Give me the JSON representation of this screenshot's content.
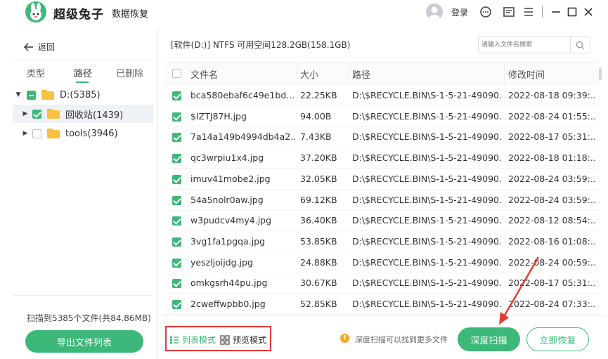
{
  "titlebar": {
    "app_name": "超级兔子",
    "app_sub": "数据恢复",
    "login": "登录"
  },
  "sidebar": {
    "back": "返回",
    "tabs": [
      "类型",
      "路径",
      "已删除"
    ],
    "active_tab": "路径",
    "tree": [
      {
        "label": "D:(5385)",
        "state": "partial",
        "expanded": true
      },
      {
        "label": "回收站(1439)",
        "state": "checked",
        "expanded": false
      },
      {
        "label": "tools(3946)",
        "state": "unchecked",
        "expanded": false
      }
    ],
    "scan_info": "扫描到5385个文件(共84.86MB)",
    "export_label": "导出文件列表"
  },
  "main": {
    "path_bar": "[软件(D:)] NTFS 可用空间128.2GB(158.1GB)",
    "search_placeholder": "请输入文件名搜索",
    "columns": [
      "文件名",
      "大小",
      "路径",
      "修改时间"
    ],
    "rows": [
      {
        "name": "bca580ebaf6c49e1bd...",
        "size": "22.25KB",
        "path": "D:\\$RECYCLE.BIN\\S-1-5-21-49090...",
        "time": "2022-08-18 09:39:..."
      },
      {
        "name": "$IZTJ87H.jpg",
        "size": "94.00B",
        "path": "D:\\$RECYCLE.BIN\\S-1-5-21-49090...",
        "time": "2022-08-24 01:55:..."
      },
      {
        "name": "7a14a149b4994db4a2...",
        "size": "7.43KB",
        "path": "D:\\$RECYCLE.BIN\\S-1-5-21-49090...",
        "time": "2022-08-17 05:31:..."
      },
      {
        "name": "qc3wrpiu1x4.jpg",
        "size": "37.20KB",
        "path": "D:\\$RECYCLE.BIN\\S-1-5-21-49090...",
        "time": "2022-08-18 01:18:..."
      },
      {
        "name": "imuv41mobe2.jpg",
        "size": "32.05KB",
        "path": "D:\\$RECYCLE.BIN\\S-1-5-21-49090...",
        "time": "2022-08-24 03:59:..."
      },
      {
        "name": "54a5nolr0aw.jpg",
        "size": "69.12KB",
        "path": "D:\\$RECYCLE.BIN\\S-1-5-21-49090...",
        "time": "2022-08-24 03:59:..."
      },
      {
        "name": "w3pudcv4my4.jpg",
        "size": "36.40KB",
        "path": "D:\\$RECYCLE.BIN\\S-1-5-21-49090...",
        "time": "2022-08-12 08:54:..."
      },
      {
        "name": "3vg1fa1pgqa.jpg",
        "size": "53.85KB",
        "path": "D:\\$RECYCLE.BIN\\S-1-5-21-49090...",
        "time": "2022-08-16 01:08:..."
      },
      {
        "name": "yeszljoijdg.jpg",
        "size": "24.88KB",
        "path": "D:\\$RECYCLE.BIN\\S-1-5-21-49090...",
        "time": "2022-08-24 00:59:..."
      },
      {
        "name": "omkgsrh44pu.jpg",
        "size": "30.67KB",
        "path": "D:\\$RECYCLE.BIN\\S-1-5-21-49090...",
        "time": "2022-08-17 05:31:..."
      },
      {
        "name": "2cweffwpbb0.jpg",
        "size": "52.85KB",
        "path": "D:\\$RECYCLE.BIN\\S-1-5-21-49090...",
        "time": "2022-08-24 07:33:..."
      }
    ]
  },
  "bottom": {
    "list_mode": "列表模式",
    "preview_mode": "预览模式",
    "hint": "深度扫描可以找到更多文件",
    "deep_scan": "深度扫描",
    "recover": "立即恢复"
  },
  "colors": {
    "accent": "#3cb878",
    "highlight": "#e53935",
    "warning": "#f5a623"
  },
  "icons": [
    "rabbit-logo-icon",
    "user-avatar-icon",
    "chat-icon",
    "message-icon",
    "menu-icon",
    "minimize-icon",
    "maximize-icon",
    "close-icon",
    "back-arrow-icon",
    "search-icon",
    "folder-icon",
    "list-mode-icon",
    "grid-mode-icon",
    "info-icon"
  ]
}
